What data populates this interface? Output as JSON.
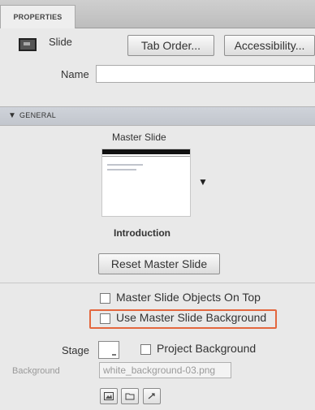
{
  "panel": {
    "tab_label": "PROPERTIES",
    "slide_label": "Slide",
    "tab_order_button": "Tab Order...",
    "accessibility_button": "Accessibility...",
    "name_label": "Name",
    "name_value": ""
  },
  "general": {
    "section_label": "GENERAL",
    "master_slide_label": "Master Slide",
    "master_slide_name": "Introduction",
    "reset_button": "Reset Master Slide",
    "master_objects_on_top_label": "Master Slide Objects On Top",
    "master_objects_on_top_checked": false,
    "use_master_background_label": "Use Master Slide Background",
    "use_master_background_checked": false,
    "stage_label": "Stage",
    "project_background_label": "Project Background",
    "project_background_checked": false,
    "background_label": "Background",
    "background_image_value": "white_background-03.png"
  },
  "icons": {
    "slide": "slide-icon",
    "edit": "edit-image-icon",
    "browse": "browse-image-icon",
    "expand": "expand-icon"
  },
  "colors": {
    "highlight": "#e3673e",
    "section_bar": "#c8ccd3"
  }
}
